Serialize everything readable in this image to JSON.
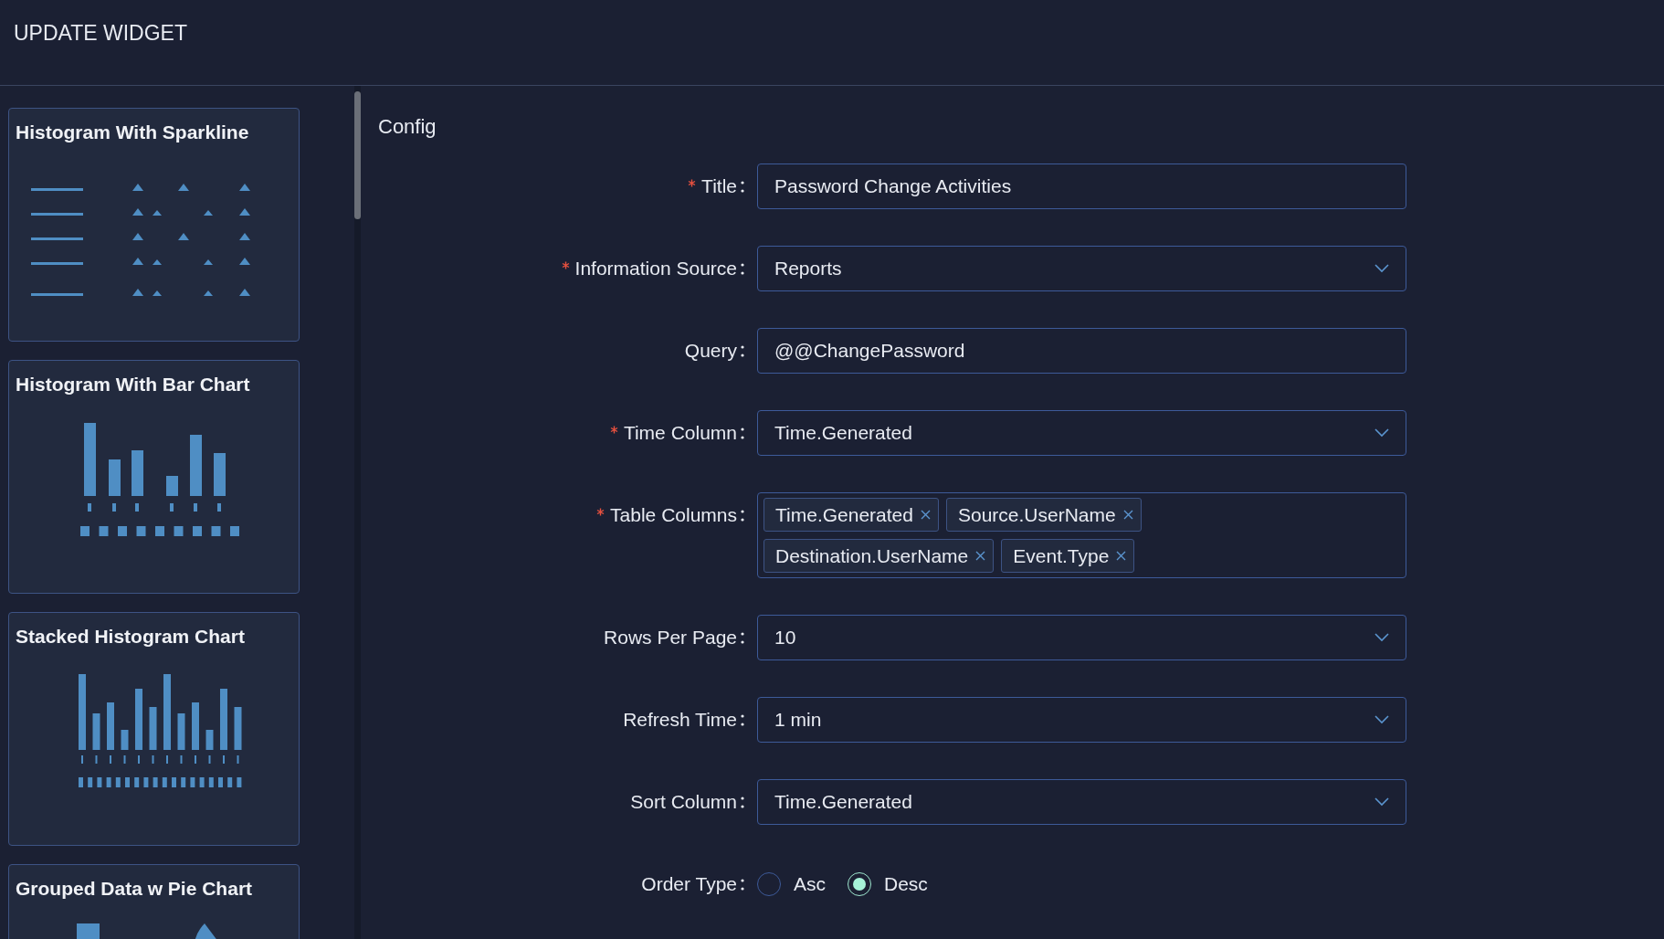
{
  "header": {
    "title": "UPDATE WIDGET"
  },
  "widget_types": [
    {
      "title": "Histogram With Sparkline",
      "kind": "sparkline"
    },
    {
      "title": "Histogram With Bar Chart",
      "kind": "bar"
    },
    {
      "title": "Stacked Histogram Chart",
      "kind": "stacked"
    },
    {
      "title": "Grouped Data w Pie Chart",
      "kind": "pie"
    }
  ],
  "config": {
    "heading": "Config",
    "fields": [
      {
        "label": "Title",
        "required": true,
        "kind": "text",
        "value": "Password Change Activities"
      },
      {
        "label": "Information Source",
        "required": true,
        "kind": "select",
        "value": "Reports"
      },
      {
        "label": "Query",
        "required": false,
        "kind": "text",
        "value": "@@ChangePassword"
      },
      {
        "label": "Time Column",
        "required": true,
        "kind": "select",
        "value": "Time.Generated"
      },
      {
        "label": "Table Columns",
        "required": true,
        "kind": "tags",
        "tags": [
          "Time.Generated",
          "Source.UserName",
          "Destination.UserName",
          "Event.Type"
        ]
      },
      {
        "label": "Rows Per Page",
        "required": false,
        "kind": "select",
        "value": "10"
      },
      {
        "label": "Refresh Time",
        "required": false,
        "kind": "select",
        "value": "1 min"
      },
      {
        "label": "Sort Column",
        "required": false,
        "kind": "select",
        "value": "Time.Generated"
      },
      {
        "label": "Order Type",
        "required": false,
        "kind": "radio",
        "options": [
          {
            "label": "Asc",
            "selected": false
          },
          {
            "label": "Desc",
            "selected": true
          }
        ]
      }
    ]
  }
}
